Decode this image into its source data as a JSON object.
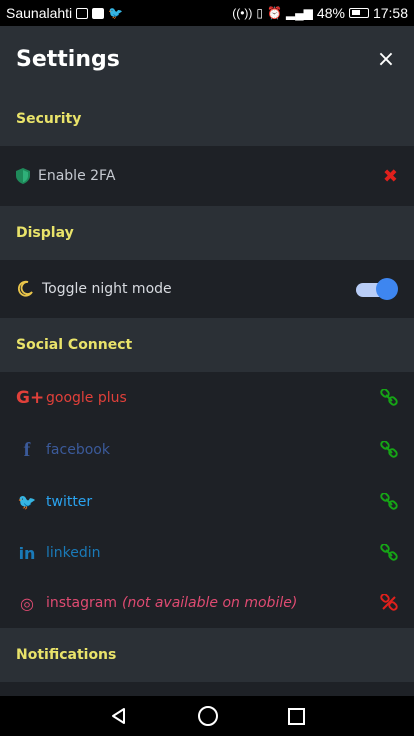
{
  "status_bar": {
    "carrier": "Saunalahti",
    "battery_percent": "48%",
    "time": "17:58"
  },
  "header": {
    "title": "Settings",
    "close_icon": "×"
  },
  "sections": {
    "security": {
      "title": "Security",
      "items": [
        {
          "label": "Enable 2FA",
          "icon": "shield-icon",
          "state": "disabled"
        }
      ]
    },
    "display": {
      "title": "Display",
      "items": [
        {
          "label": "Toggle night mode",
          "icon": "moon-icon",
          "enabled": true
        }
      ]
    },
    "social_connect": {
      "title": "Social Connect",
      "items": [
        {
          "icon_text": "G+",
          "label": "google plus",
          "color": "#e0403a",
          "linked": true
        },
        {
          "icon_text": "f",
          "label": "facebook",
          "color": "#3b5a9a",
          "linked": true
        },
        {
          "icon_text": "🐦",
          "label": "twitter",
          "color": "#2aa3ef",
          "linked": true
        },
        {
          "icon_text": "in",
          "label": "linkedin",
          "color": "#1a7ab8",
          "linked": true
        },
        {
          "icon_text": "◎",
          "label": "instagram",
          "note": "(not available on mobile)",
          "color": "#e04b72",
          "linked": false
        }
      ]
    },
    "notifications": {
      "title": "Notifications"
    }
  },
  "colors": {
    "section_title": "#e9e36a",
    "link_ok": "#16a516",
    "link_broken": "#e0201c",
    "toggle_knob": "#3e86f0"
  }
}
